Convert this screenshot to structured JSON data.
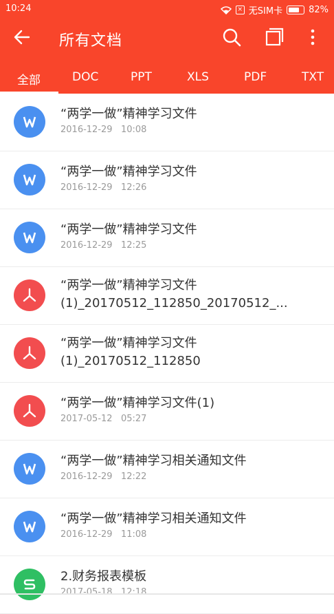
{
  "status_bar": {
    "time": "10:24",
    "sim_status": "无SIM卡",
    "battery": "82%",
    "battery_level": 0.82
  },
  "app_bar": {
    "title": "所有文档",
    "icons": [
      "back-arrow-icon",
      "search-icon",
      "multi-select-icon",
      "more-vertical-icon"
    ]
  },
  "tabs": [
    {
      "label": "全部",
      "active": true
    },
    {
      "label": "DOC",
      "active": false
    },
    {
      "label": "PPT",
      "active": false
    },
    {
      "label": "XLS",
      "active": false
    },
    {
      "label": "PDF",
      "active": false
    },
    {
      "label": "TXT",
      "active": false
    }
  ],
  "colors": {
    "brand": "#f9452b",
    "word": "#4a90f0",
    "pdf": "#f24d4f",
    "sheet": "#2fbf63"
  },
  "files": [
    {
      "type": "word",
      "name": "“两学一做”精神学习文件",
      "date": "2016-12-29",
      "time": "10:08"
    },
    {
      "type": "word",
      "name": "“两学一做”精神学习文件",
      "date": "2016-12-29",
      "time": "12:26"
    },
    {
      "type": "word",
      "name": "“两学一做”精神学习文件",
      "date": "2016-12-29",
      "time": "12:25"
    },
    {
      "type": "pdf",
      "name": "“两学一做”精神学习文件",
      "name2": "(1)_20170512_112850_20170512_...",
      "date": "",
      "time": ""
    },
    {
      "type": "pdf",
      "name": "“两学一做”精神学习文件",
      "name2": "(1)_20170512_112850",
      "date": "",
      "time": ""
    },
    {
      "type": "pdf",
      "name": "“两学一做”精神学习文件(1)",
      "date": "2017-05-12",
      "time": "05:27"
    },
    {
      "type": "word",
      "name": "“两学一做”精神学习相关通知文件",
      "date": "2016-12-29",
      "time": "12:22"
    },
    {
      "type": "word",
      "name": "“两学一做”精神学习相关通知文件",
      "date": "2016-12-29",
      "time": "11:08"
    },
    {
      "type": "sheet",
      "name": "2.财务报表模板",
      "date": "2017-05-18",
      "time": "12:18"
    }
  ]
}
